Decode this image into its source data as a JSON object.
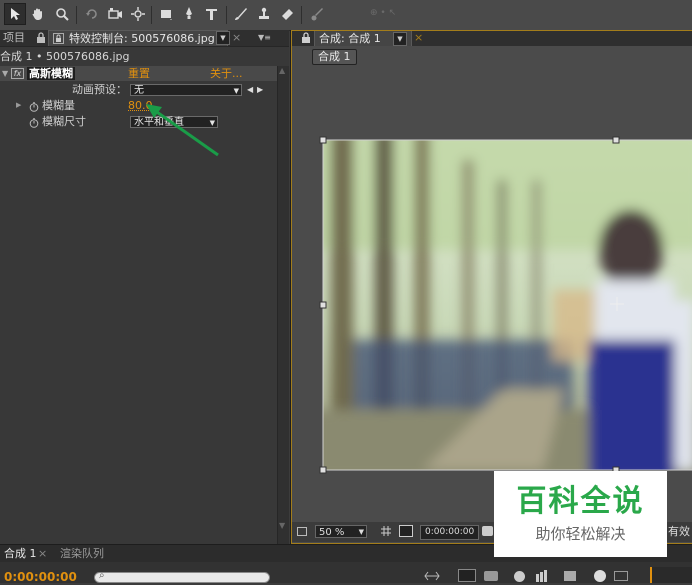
{
  "toolbar": {
    "tools": [
      "selection-tool",
      "hand-tool",
      "zoom-tool",
      "rotate-tool",
      "camera-tool",
      "pan-behind-tool",
      "rectangle-tool",
      "pen-tool",
      "text-tool",
      "brush-tool",
      "clone-stamp-tool",
      "eraser-tool",
      "roto-brush-tool"
    ],
    "axis_label": "⊕ • ↖"
  },
  "left_panel": {
    "tabs": {
      "project": "项目",
      "effect_controls": "特效控制台: 500576086.jpg",
      "menu_glyph": "▼",
      "close_glyph": "×",
      "options_glyph": "▼≡"
    },
    "breadcrumb": "合成 1 • 500576086.jpg",
    "effect": {
      "fx_badge": "fx",
      "name": "高斯模糊",
      "reset_label": "重置",
      "about_label": "关于..."
    },
    "animation_preset": {
      "label": "动画预设：",
      "value": "无",
      "prev": "◀",
      "next": "▶"
    },
    "blurriness": {
      "label": "模糊量",
      "value": "80.0"
    },
    "blur_dimensions": {
      "label": "模糊尺寸",
      "value": "水平和垂直"
    }
  },
  "viewer": {
    "tab_label": "合成: 合成 1",
    "tab_menu": "▼",
    "tab_close": "×",
    "comp_button": "合成 1",
    "zoom_value": "50 %",
    "timecode": "0:00:00:00",
    "right_edge_text": "有效"
  },
  "bottom_panel": {
    "tabs": [
      "合成 1",
      "渲染队列"
    ],
    "tab_close": "×",
    "timecode": "0:00:00:00",
    "search_icon_glyph": "⌕"
  },
  "watermark": {
    "title": "百科全说",
    "subtitle": "助你轻松解决"
  },
  "colors": {
    "accent_orange": "#e0900f",
    "watermark_green": "#2aa84a",
    "annotation_arrow": "#1a9c48"
  }
}
